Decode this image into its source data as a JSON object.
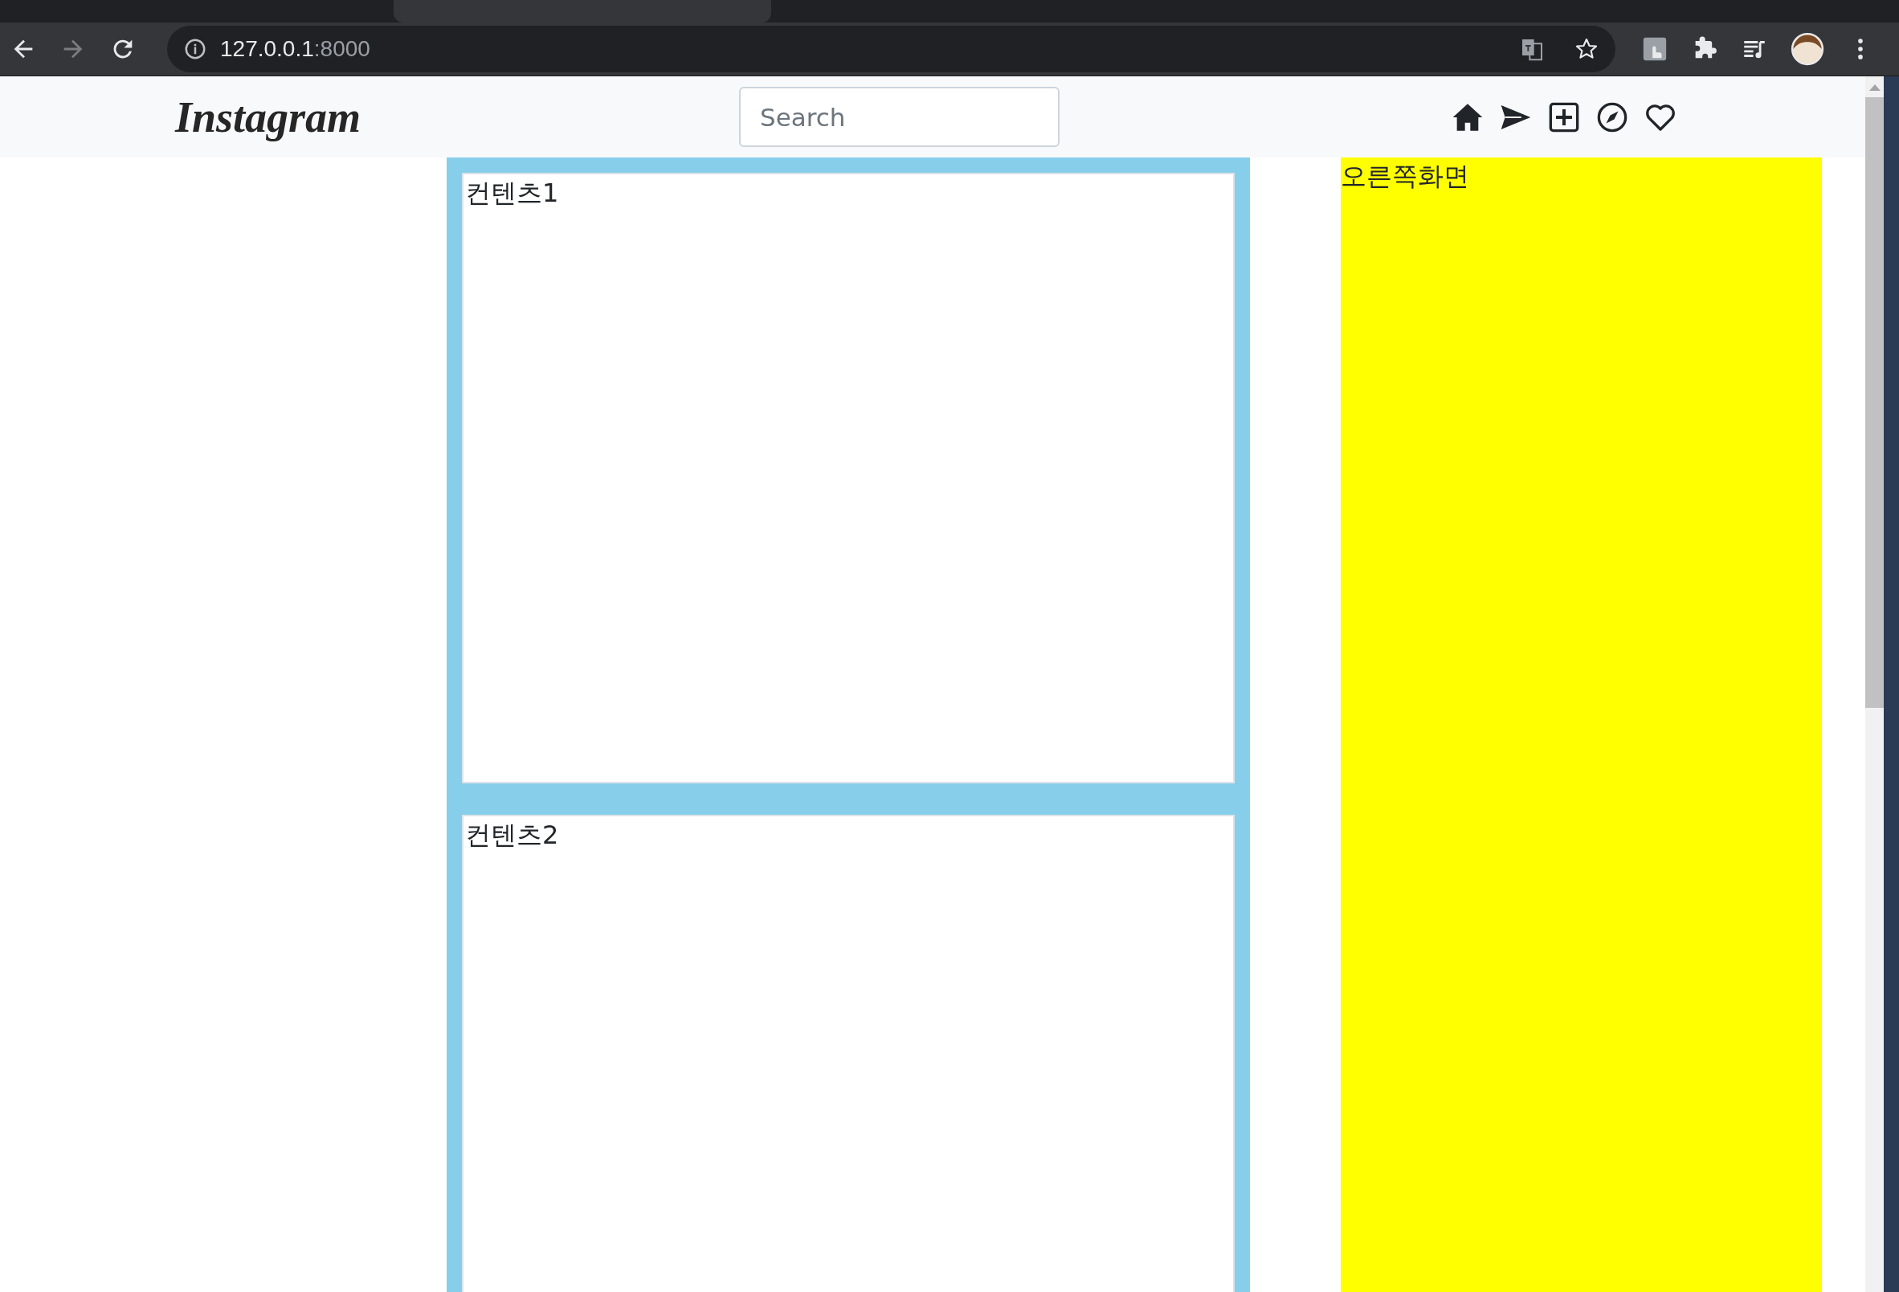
{
  "browser": {
    "address": {
      "host": "127.0.0.1",
      "port": ":8000"
    }
  },
  "navbar": {
    "logo": "Instagram",
    "search": {
      "placeholder": "Search"
    }
  },
  "feed": {
    "posts": [
      {
        "text": "컨텐츠1"
      },
      {
        "text": "컨텐츠2"
      }
    ]
  },
  "sidebar": {
    "text": "오른쪽화면"
  }
}
